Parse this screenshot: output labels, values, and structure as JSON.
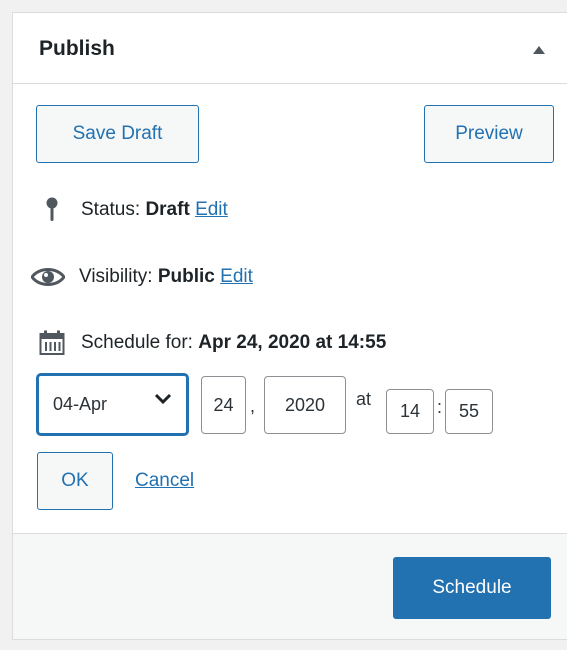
{
  "colors": {
    "accent": "#2271b1",
    "panel_bg": "#ffffff",
    "footer_bg": "#f6f7f7",
    "border": "#dcdcde"
  },
  "panel": {
    "title": "Publish",
    "toggle_icon": "triangle-up-icon"
  },
  "actions": {
    "save_draft": "Save Draft",
    "preview": "Preview"
  },
  "status": {
    "icon": "pin-icon",
    "label": "Status:",
    "value": "Draft",
    "edit": "Edit"
  },
  "visibility": {
    "icon": "eye-icon",
    "label": "Visibility:",
    "value": "Public",
    "edit": "Edit"
  },
  "schedule": {
    "icon": "calendar-icon",
    "label": "Schedule for:",
    "value": "Apr 24, 2020 at 14:55",
    "month": "04-Apr",
    "day": "24",
    "day_sep": ",",
    "year": "2020",
    "at": "at",
    "hour": "14",
    "time_sep": ":",
    "minute": "55",
    "ok": "OK",
    "cancel": "Cancel"
  },
  "footer": {
    "schedule_button": "Schedule"
  }
}
